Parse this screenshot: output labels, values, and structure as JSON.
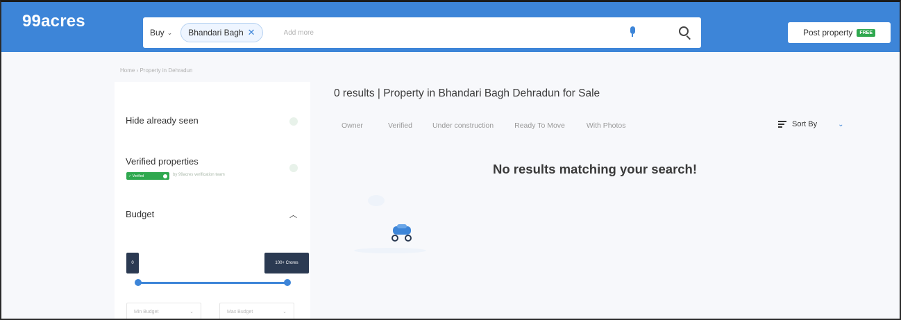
{
  "header": {
    "logo": "99acres",
    "buy_label": "Buy",
    "chip_label": "Bhandari Bagh",
    "add_more_placeholder": "Add more",
    "post_label": "Post property",
    "free_badge": "FREE"
  },
  "breadcrumb": "Home › Property in Dehradun",
  "sidebar": {
    "hide_seen": "Hide already seen",
    "verified_title": "Verified properties",
    "verified_badge": "✓ Verified",
    "verified_note": "by 99acres verification team",
    "budget_title": "Budget",
    "min_value": "0",
    "max_value": "100+ Crores",
    "min_budget": "Min Budget",
    "max_budget": "Max Budget"
  },
  "main": {
    "results_title": "0 results | Property in Bhandari Bagh Dehradun for Sale",
    "tabs": [
      "Owner",
      "Verified",
      "Under construction",
      "Ready To Move",
      "With Photos"
    ],
    "sort_label": "Sort By",
    "no_results": "No results matching your search!"
  },
  "colors": {
    "brand_blue": "#3d85d8",
    "verified_green": "#2fa84f",
    "dark_bubble": "#2b3a52"
  }
}
